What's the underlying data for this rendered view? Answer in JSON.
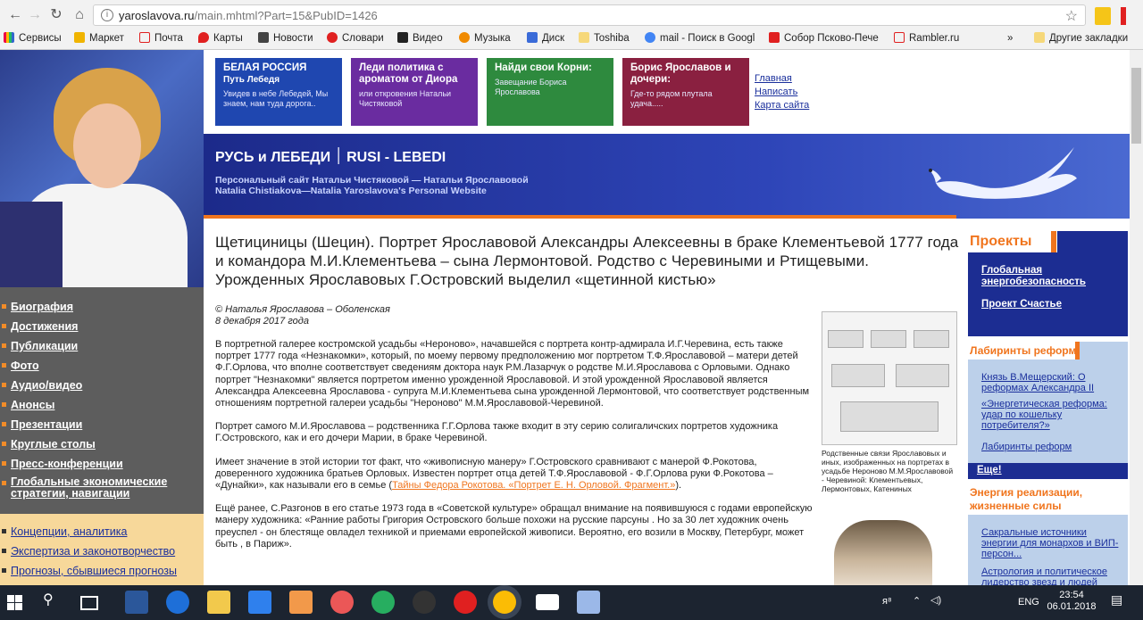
{
  "browser": {
    "url_host": "yaroslavova.ru",
    "url_path": "/main.mhtml?Part=15&PubID=1426",
    "bookmarks": [
      "Сервисы",
      "Маркет",
      "Почта",
      "Карты",
      "Новости",
      "Словари",
      "Видео",
      "Музыка",
      "Диск",
      "Toshiba",
      "mail - Поиск в Googl",
      "Собор Псково-Пече",
      "Rambler.ru",
      "Другие закладки"
    ],
    "more_label": "»"
  },
  "menu": {
    "main": [
      "Биография",
      "Достижения",
      "Публикации",
      "Фото",
      "Аудио/видео",
      "Анонсы",
      "Презентации",
      "Круглые столы",
      "Пресс-конференции",
      "Глобальные экономические стратегии, навигации"
    ],
    "secondary": [
      "Концепции, аналитика",
      "Экспертиза и законотворчество",
      "Прогнозы, сбывшиеся прогнозы"
    ]
  },
  "banners": [
    {
      "title": "БЕЛАЯ РОССИЯ",
      "sub_title": "Путь Лебедя",
      "text": "Увидев в небе Лебедей, Мы знаем, нам туда дорога..",
      "color": "#1f47b0"
    },
    {
      "title": "Леди политика с ароматом от Диора",
      "sub_title": "",
      "text": "или откровения Натальи Чистяковой",
      "color": "#6a2ca0"
    },
    {
      "title": "Найди свои Корни:",
      "sub_title": "",
      "text": "Завещание Бориса Ярославова",
      "color": "#2e8a3e"
    },
    {
      "title": "Борис Ярославов и дочери:",
      "sub_title": "",
      "text": "Где-то рядом плутала удача.....",
      "color": "#8a2040"
    }
  ],
  "toplinks": [
    "Главная",
    "Написать",
    "Карта сайта"
  ],
  "header": {
    "title": "РУСЬ и ЛЕБЕДИ ׀ RUSI - LEBEDI",
    "line1": "Персональный сайт Натальи Чистяковой — Натальи Ярославовой",
    "line2": "Natalia Chistiakova—Natalia Yaroslavova's  Personal Website"
  },
  "article": {
    "title": "Щетициницы (Шецин). Портрет Ярославовой Александры Алексеевны в браке Клементьевой 1777 года и командора М.И.Клементьева – сына Лермонтовой. Родство с Черевиными и Ртищевыми. Урожденных Ярославовых Г.Островский выделил «щетинной кистью»",
    "author": "© Наталья Ярославова – Оболенская",
    "date": "8 декабря 2017 года",
    "p1": "В портретной галерее костромской усадьбы «Нероново», начавшейся с портрета контр-адмирала И.Г.Черевина, есть также портрет 1777 года «Незнакомки», который, по моему первому предположению мог портретом Т.Ф.Ярославовой – матери детей Ф.Г.Орлова, что вполне соответствует сведениям доктора наук Р.М.Лазарчук о родстве М.И.Ярославова с Орловыми. Однако портрет \"Незнакомки\" является портретом именно урожденной Ярославовой. И этой урожденной Ярославовой является Александра Алексеевна Ярославова - супруга М.И.Клементьева сына урожденной Лермонтовой, что соответствует родственным отношениям портретной галереи усадьбы \"Нероново\" М.М.Ярославовой-Черевиной.",
    "p2": "Портрет самого М.И.Ярославова – родственника Г.Г.Орлова также входит в эту серию солигаличских портретов художника Г.Островского, как и его дочери Марии, в браке Черевиной.",
    "p3a": "Имеет значение в этой истории тот факт, что «живописную манеру» Г.Островского сравнивают с манерой Ф.Рокотова, доверенного художника братьев Орловых. Известен портрет отца детей Т.Ф.Ярославовой - Ф.Г.Орлова руки Ф.Рокотова – «Дунайки», как называли его в семье (",
    "p3link": "Тайны Федора Рокотова. «Портрет Е. Н. Орловой. Фрагмент.»",
    "p3b": ").",
    "p4": "Ещё ранее, С.Разгонов в его статье 1973 года в «Советской культуре» обращал внимание на появившуюся с годами европейскую манеру художника: «Ранние работы Григория Островского больше похожи на русские парсуны . Но за 30 лет художник очень преуспел - он блестяще овладел техникой и приемами европейской живописи. Вероятно, его возили в Москву, Петербург, может быть , в Париж».",
    "figure_caption": "Родственные связи Ярославовых и иных, изображенных на портретах в усадьбе Нероново М.М.Ярославовой - Черевиной: Клементьевых, Лермонтовых, Катениных"
  },
  "sidebar": {
    "projects_title": "Проекты",
    "projects": [
      "Глобальная энергобезопасность",
      "Проект Счастье"
    ],
    "sec1_title": "Лабиринты реформ",
    "sec1_links": [
      "Князь В.Мещерский: О реформах Александра II",
      "«Энергетическая реформа: удар по кошельку потребителя?»",
      "Лабиринты реформ"
    ],
    "more": "Еще!",
    "sec2_title": "Энергия реализации, жизненные силы",
    "sec2_links": [
      "Сакральные источники энергии для монархов и ВИП-персон...",
      "Астрология и политическое лидерство звезд и людей"
    ]
  },
  "taskbar": {
    "time": "23:54",
    "date": "06.01.2018",
    "lang": "ENG"
  }
}
